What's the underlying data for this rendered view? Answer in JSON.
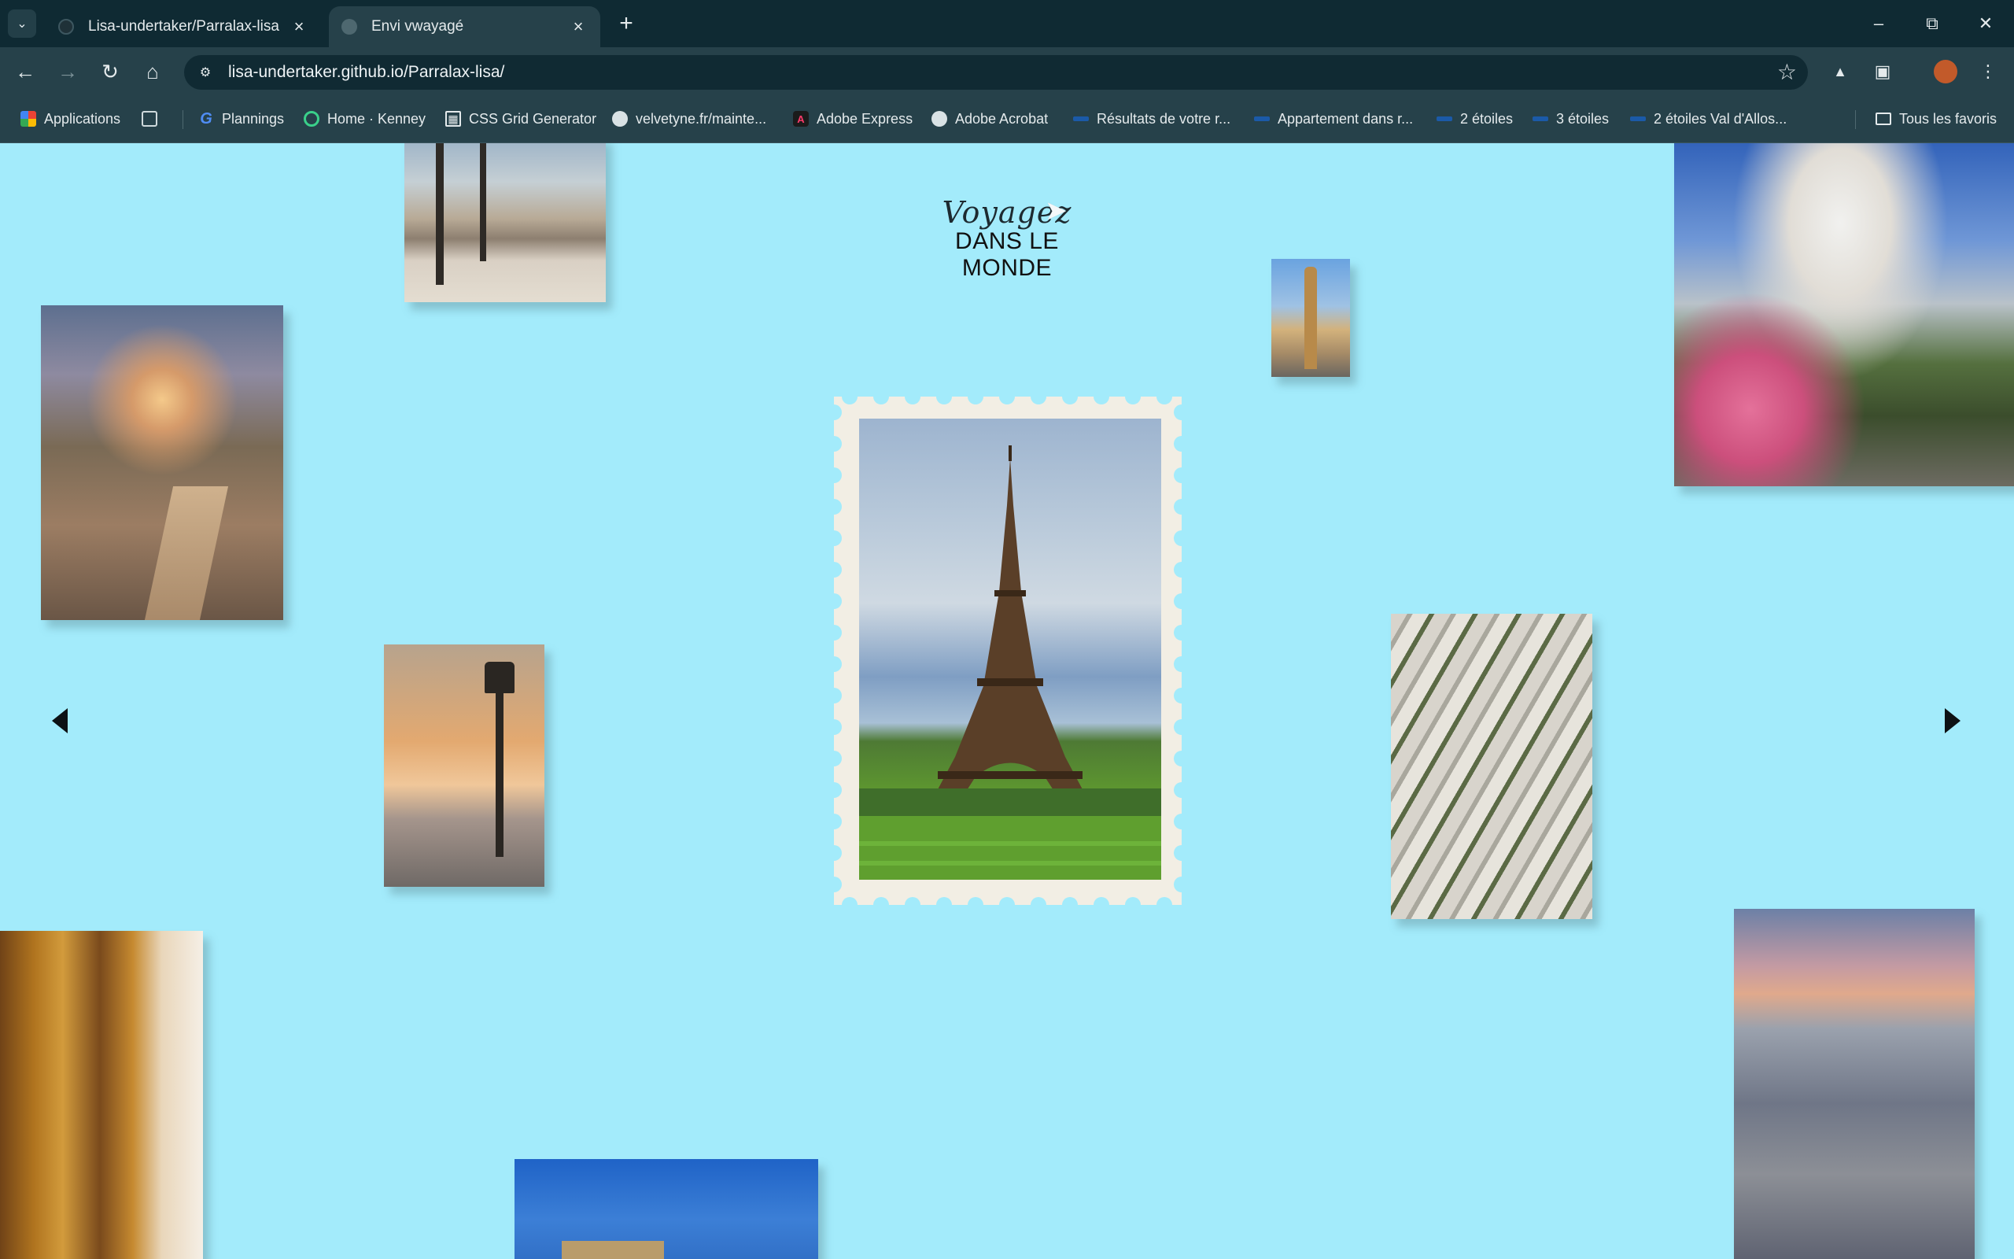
{
  "browser": {
    "tabs": [
      {
        "title": "Lisa-undertaker/Parralax-lisa",
        "active": false
      },
      {
        "title": "Envi vwayagé",
        "active": true
      }
    ],
    "url": "lisa-undertaker.github.io/Parralax-lisa/",
    "bookmarks": [
      {
        "label": "Applications",
        "icon": "apps-icon"
      },
      {
        "label": "",
        "icon": "tab-groups-icon"
      },
      {
        "label": "Plannings",
        "icon": "google-icon"
      },
      {
        "label": "Home · Kenney",
        "icon": "kenney-icon"
      },
      {
        "label": "CSS Grid Generator",
        "icon": "css-grid-icon"
      },
      {
        "label": "velvetyne.fr/mainte...",
        "icon": "globe-icon"
      },
      {
        "label": "Adobe Express",
        "icon": "adobe-icon"
      },
      {
        "label": "Adobe Acrobat",
        "icon": "globe-icon"
      },
      {
        "label": "Résultats de votre r...",
        "icon": "bookmark-icon"
      },
      {
        "label": "Appartement dans r...",
        "icon": "bookmark-icon"
      },
      {
        "label": "2 étoiles",
        "icon": "bookmark-icon"
      },
      {
        "label": "3 étoiles",
        "icon": "bookmark-icon"
      },
      {
        "label": "2 étoiles Val d'Allos...",
        "icon": "bookmark-icon"
      }
    ],
    "all_bookmarks": "Tous les favoris"
  },
  "page": {
    "logo_script": "Voyagez",
    "logo_sub": "DANS LE MONDE",
    "background": "#a3ebfb",
    "photos": [
      {
        "name": "photo-bridge-lampposts",
        "subject": "Paris bridge with lampposts"
      },
      {
        "name": "photo-montmartre-street",
        "subject": "Montmartre street at dusk"
      },
      {
        "name": "photo-street-lamp-sunset",
        "subject": "street lamp at sunset"
      },
      {
        "name": "photo-pont-alexandre",
        "subject": "Pont Alexandre III column"
      },
      {
        "name": "photo-sacre-coeur",
        "subject": "Sacré-Cœur with carousel"
      },
      {
        "name": "photo-aerial-paris",
        "subject": "aerial view of Paris boulevards"
      },
      {
        "name": "photo-restaurant-facade",
        "subject": "ornate restaurant facade"
      },
      {
        "name": "photo-paris-rooftops",
        "subject": "Paris rooftops at sunset"
      },
      {
        "name": "photo-arc-de-triomphe",
        "subject": "Arc de Triomphe under blue sky"
      }
    ],
    "stamp": {
      "subject": "Eiffel Tower postage stamp"
    }
  }
}
